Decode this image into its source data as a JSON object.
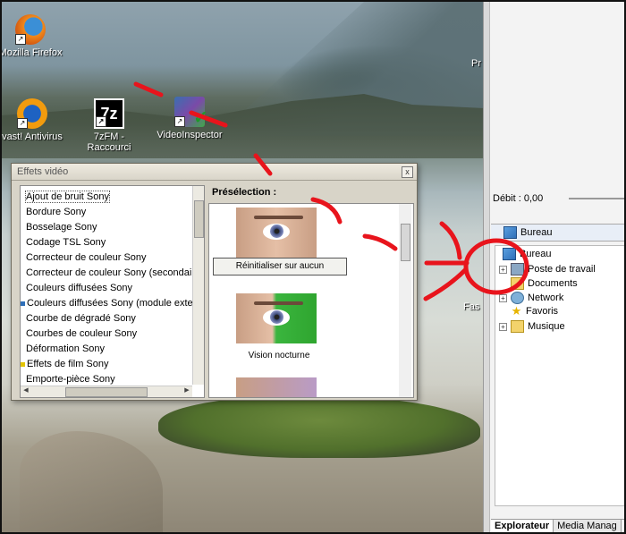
{
  "desktop": {
    "icons": [
      {
        "label": "Mozilla Firefox",
        "icon": "firefox-icon"
      },
      {
        "label": "vast! Antivirus",
        "icon": "avast-icon"
      },
      {
        "label": "7zFM - Raccourci",
        "icon": "7zip-icon",
        "glyph": "7z"
      },
      {
        "label": "VideoInspector",
        "icon": "video-inspector-icon"
      }
    ],
    "edge_label_pr": "Pr",
    "edge_label_fas": "Fas"
  },
  "dialog": {
    "title": "Effets vidéo",
    "close_glyph": "x",
    "effects": [
      "Ajout de bruit Sony",
      "Bordure Sony",
      "Bosselage Sony",
      "Codage TSL Sony",
      "Correcteur de couleur Sony",
      "Correcteur de couleur Sony (secondai",
      "Couleurs diffusées Sony",
      "Couleurs diffusées Sony (module exter",
      "Courbe de dégradé Sony",
      "Courbes de couleur Sony",
      "Déformation Sony",
      "Effets de film Sony",
      "Emporte-pièce Sony"
    ],
    "preset_label": "Présélection :",
    "presets": [
      {
        "label": "Réinitialiser sur aucun"
      },
      {
        "label": "Vision nocturne"
      }
    ]
  },
  "explorer": {
    "debit_label": "Débit : 0,00",
    "header": "Bureau",
    "tree": [
      {
        "label": "Bureau",
        "icon": "desktop-icon"
      },
      {
        "label": "Poste de travail",
        "icon": "computer-icon"
      },
      {
        "label": "Documents",
        "icon": "folder-icon"
      },
      {
        "label": "Network",
        "icon": "network-icon"
      },
      {
        "label": "Favoris",
        "icon": "star-icon"
      },
      {
        "label": "Musique",
        "icon": "music-icon"
      }
    ],
    "tabs": [
      "Explorateur",
      "Media Manag"
    ]
  },
  "colors": {
    "annotation": "#e8141c",
    "accent": "#2f6fb8"
  }
}
